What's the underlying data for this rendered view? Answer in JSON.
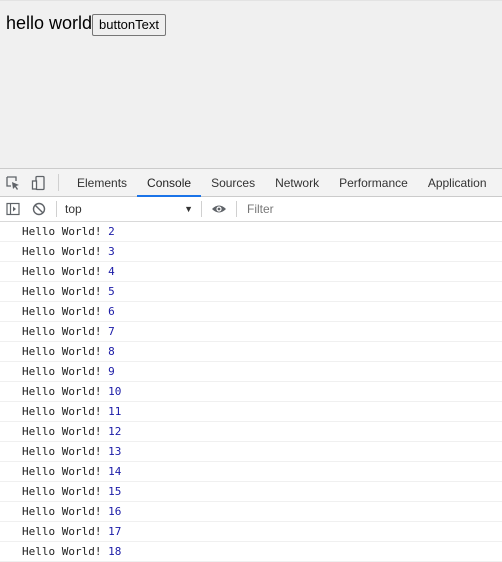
{
  "page": {
    "text": "hello world",
    "button_label": "buttonText"
  },
  "devtools": {
    "tabs": [
      "Elements",
      "Console",
      "Sources",
      "Network",
      "Performance",
      "Application"
    ],
    "active_tab": "Console",
    "toolbar": {
      "context": "top",
      "filter_placeholder": "Filter"
    },
    "log_messages": [
      {
        "text": "Hello World!",
        "value": "2"
      },
      {
        "text": "Hello World!",
        "value": "3"
      },
      {
        "text": "Hello World!",
        "value": "4"
      },
      {
        "text": "Hello World!",
        "value": "5"
      },
      {
        "text": "Hello World!",
        "value": "6"
      },
      {
        "text": "Hello World!",
        "value": "7"
      },
      {
        "text": "Hello World!",
        "value": "8"
      },
      {
        "text": "Hello World!",
        "value": "9"
      },
      {
        "text": "Hello World!",
        "value": "10"
      },
      {
        "text": "Hello World!",
        "value": "11"
      },
      {
        "text": "Hello World!",
        "value": "12"
      },
      {
        "text": "Hello World!",
        "value": "13"
      },
      {
        "text": "Hello World!",
        "value": "14"
      },
      {
        "text": "Hello World!",
        "value": "15"
      },
      {
        "text": "Hello World!",
        "value": "16"
      },
      {
        "text": "Hello World!",
        "value": "17"
      },
      {
        "text": "Hello World!",
        "value": "18"
      }
    ],
    "colors": {
      "active_tab_underline": "#1a73e8",
      "log_number": "#1a1aa6"
    },
    "icons": [
      "inspect-element-icon",
      "device-toolbar-icon",
      "sidebar-toggle-icon",
      "clear-console-icon",
      "eye-icon"
    ]
  }
}
